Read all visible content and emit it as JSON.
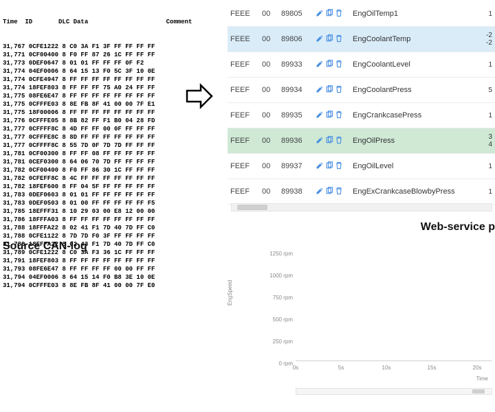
{
  "canlog": {
    "header": "Time  ID       DLC Data                     Comment",
    "rows": [
      "31,767 0CFE1222 8 C0 3A F1 3F FF FF FF FF",
      "31,771 0CF00400 8 F0 FF 87 26 1C FF FF FF",
      "31,773 0DEF0647 8 01 01 FF FF FF 0F F2",
      "31,774 04EF0006 8 64 15 13 F0 5C 3F 10 0E",
      "31,774 0CFE4947 8 FF FF FF FF FF FF FF FF",
      "31,774 18FEF803 8 FF FF FF 75 A0 24 FF FF",
      "31,775 08FE6E47 8 FF FF FF FF FF FF FF FF",
      "31,775 0CFFFE03 8 8E FB 8F 41 00 00 7F E1",
      "31,775 18F00006 8 FF FF FF FF FF FF FF FF",
      "31,776 0CFFFE05 8 8B 82 FF F1 B0 04 28 FD",
      "31,777 0CFFFF8C 8 4D FF FF 00 0F FF FF FF",
      "31,777 0CFFFE8C 8 8D FF FF FF FF FF FF FF",
      "31,777 0CFFFF8C 8 55 7D 0F 7D 7D FF FF FF",
      "31,781 0CF00300 8 FF FF 08 FF FF FF FF FF",
      "31,781 0CEF0300 8 64 06 70 7D FF FF FF FF",
      "31,782 0CF00400 8 F0 FF 86 30 1C FF FF FF",
      "31,782 0CFEFF8C 8 4C FF FF FF FF FF FF FF",
      "31,782 18FEF600 8 FF 04 5F FF FF FF FF FF",
      "31,783 0DEF0603 8 01 01 FF FF FF FF FF FF",
      "31,783 0DEF0503 8 01 00 FF FF FF FF FF F5",
      "31,785 18EFFF31 8 10 29 03 00 E8 12 00 00",
      "31,786 18FFFA03 8 FF FF FF FF FF FF FF FF",
      "31,788 18FFFA22 8 02 41 F1 7D 40 7D FF C0",
      "31,788 0CFE1122 8 7D 7D F0 3F FF FF FF FF",
      "31,788 18FFFA22 8 02 43 F1 7D 40 7D FF C0",
      "31,789 0CFE1222 8 C0 3A F3 36 1C FF FF FF",
      "31,791 18FEF803 8 FF FF FF FF FF FF FF FF",
      "31,793 08FE6E47 8 FF FF FF FF 00 00 FF FF",
      "31,794 04EF0006 8 64 15 14 F0 B8 3E 10 0E",
      "31,794 0CFFFE03 8 8E FB 8F 41 00 00 7F E0"
    ]
  },
  "labels": {
    "source": "Source CAN-log",
    "webservice": "Web-service p"
  },
  "table": {
    "rows": [
      {
        "id": "FEEE",
        "sub": "00",
        "num": "89805",
        "name": "EngOilTemp1",
        "tail": "1",
        "cls": ""
      },
      {
        "id": "FEEE",
        "sub": "00",
        "num": "89806",
        "name": "EngCoolantTemp",
        "tail": "-2\n-2",
        "cls": "highlight-blue"
      },
      {
        "id": "FEEF",
        "sub": "00",
        "num": "89933",
        "name": "EngCoolantLevel",
        "tail": "1",
        "cls": ""
      },
      {
        "id": "FEEF",
        "sub": "00",
        "num": "89934",
        "name": "EngCoolantPress",
        "tail": "5",
        "cls": ""
      },
      {
        "id": "FEEF",
        "sub": "00",
        "num": "89935",
        "name": "EngCrankcasePress",
        "tail": "1",
        "cls": ""
      },
      {
        "id": "FEEF",
        "sub": "00",
        "num": "89936",
        "name": "EngOilPress",
        "tail": "3\n4",
        "cls": "highlight-green"
      },
      {
        "id": "FEEF",
        "sub": "00",
        "num": "89937",
        "name": "EngOilLevel",
        "tail": "1",
        "cls": ""
      },
      {
        "id": "FEEF",
        "sub": "00",
        "num": "89938",
        "name": "EngExCrankcaseBlowbyPress",
        "tail": "1",
        "cls": ""
      }
    ]
  },
  "chart_data": {
    "type": "line",
    "title": "",
    "ylabel": "EngSpeed",
    "xlabel": "Time",
    "ylim": [
      0,
      1250
    ],
    "yticks": [
      "1250 rpm",
      "1000 rpm",
      "750 rpm",
      "500 rpm",
      "250 rpm",
      "0 rpm"
    ],
    "xticks": [
      "0s",
      "5s",
      "10s",
      "15s",
      "20s"
    ],
    "series": [
      {
        "name": "EngSpeed",
        "x": [],
        "values": []
      }
    ]
  }
}
